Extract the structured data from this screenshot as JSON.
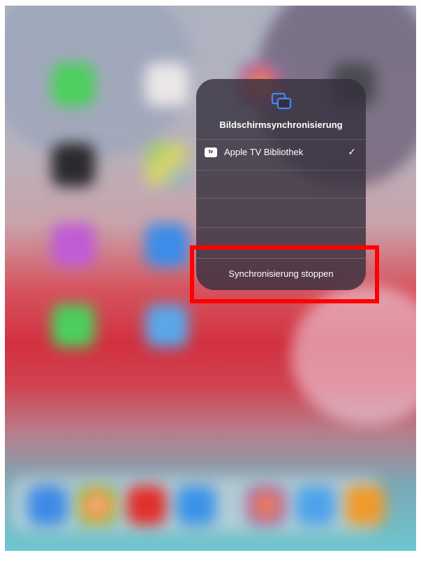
{
  "mirroring_panel": {
    "icon": "screen-mirroring-icon",
    "title": "Bildschirmsynchronisierung",
    "devices": [
      {
        "badge_text": "tv",
        "name": "Apple TV Bibliothek",
        "selected_mark": "✓"
      }
    ],
    "stop_label": "Synchronisierung stoppen"
  },
  "home_apps": [
    "facetime-icon",
    "calendar-icon",
    "photos-icon",
    "camera-icon",
    "clock-icon",
    "maps-icon",
    "itunes-store-icon",
    "app-store-icon",
    "messages-icon",
    "safari-icon"
  ],
  "dock_apps": [
    "app-store-icon",
    "chrome-icon",
    "youtube-icon",
    "files-icon",
    "photos-icon",
    "safari-icon",
    "vlc-icon"
  ],
  "colors": {
    "highlight": "#ff0000",
    "panel_background": "#342e3c",
    "mirror_icon": "#3f8cff"
  }
}
